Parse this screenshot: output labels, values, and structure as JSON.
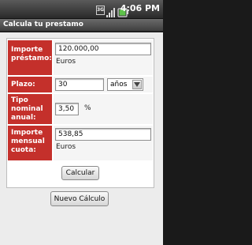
{
  "status_bar": {
    "network_label": "3G",
    "signal_icon": "signal-bars-icon",
    "battery_icon": "battery-icon",
    "time": "4:06 PM"
  },
  "app": {
    "title": "Calcula tu prestamo"
  },
  "form": {
    "loan_amount": {
      "label": "Importe préstamo:",
      "value": "120.000,00",
      "unit": "Euros"
    },
    "term": {
      "label": "Plazo:",
      "value": "30",
      "unit_selected": "años"
    },
    "interest_rate": {
      "label": "Tipo nominal anual:",
      "value": "3,50",
      "unit": "%"
    },
    "monthly_payment": {
      "label": "Importe mensual cuota:",
      "value": "538,85",
      "unit": "Euros"
    },
    "calculate_label": "Calcular"
  },
  "actions": {
    "new_calculation_label": "Nuevo Cálculo"
  },
  "colors": {
    "label_background": "#c4302b",
    "label_text": "#ffffff",
    "title_bar": "#4a4a4a"
  }
}
